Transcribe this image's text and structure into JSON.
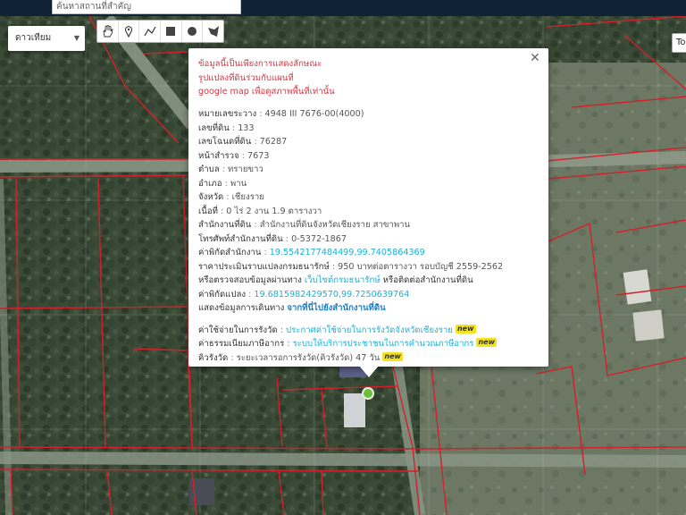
{
  "search": {
    "placeholder": "ค้นหาสถานที่สำคัญ"
  },
  "map_type": {
    "selected": "ดาวเทียม"
  },
  "toolbar": {
    "tools": [
      "hand-icon",
      "pin-icon",
      "polyline-icon",
      "square-icon",
      "circle-icon",
      "polygon-icon"
    ]
  },
  "top_right_button": {
    "label": "To"
  },
  "popup": {
    "warning": [
      "ข้อมูลนี้เป็นเพียงการแสดงลักษณะ",
      "รูปแปลงที่ดินร่วมกับแผนที่",
      "google map เพื่อดูสภาพพื้นที่เท่านั้น"
    ],
    "fields": {
      "map_sheet": {
        "label": "หมายเลขระวาง",
        "value": "4948 III 7676-00(4000)"
      },
      "parcel_no": {
        "label": "เลขที่ดิน",
        "value": "133"
      },
      "deed_no": {
        "label": "เลขโฉนดที่ดิน",
        "value": "76287"
      },
      "survey_page": {
        "label": "หน้าสำรวจ",
        "value": "7673"
      },
      "tambon": {
        "label": "ตำบล",
        "value": "ทรายขาว"
      },
      "amphoe": {
        "label": "อำเภอ",
        "value": "พาน"
      },
      "province": {
        "label": "จังหวัด",
        "value": "เชียงราย"
      },
      "area": {
        "label": "เนื้อที่",
        "value": "0 ไร่ 2 งาน 1.9 ตารางวา"
      },
      "land_office": {
        "label": "สำนักงานที่ดิน",
        "value": "สำนักงานที่ดินจังหวัดเชียงราย สาขาพาน"
      },
      "office_phone": {
        "label": "โทรศัพท์สำนักงานที่ดิน",
        "value": "0-5372-1867"
      },
      "office_coords": {
        "label": "ค่าพิกัดสำนักงาน",
        "value": "19.5542177484499,99.7405864369"
      },
      "appraisal": {
        "label": "ราคาประเมินราบแปลงกรมธนารักษ์",
        "value": "950 บาทต่อตารางวา รอบบัญชี 2559-2562"
      },
      "check_line": {
        "prefix": "หรือตรวจสอบข้อมูลผ่านทาง",
        "link": "เว็บไซต์กรมธนารักษ์",
        "suffix": "หรือติดต่อสำนักงานที่ดิน"
      },
      "parcel_coords": {
        "label": "ค่าพิกัดแปลง",
        "value": "19.6815982429570,99.7250639764"
      },
      "route_line": {
        "prefix": "แสดงข้อมูลการเดินทาง",
        "link": "จากที่นี่ไปยังสำนักงานที่ดิน"
      },
      "fee": {
        "label": "ค่าใช้จ่ายในการรังวัด",
        "link": "ประกาศค่าใช้จ่ายในการรังวัดจังหวัดเชียงราย",
        "badge": "new"
      },
      "tax": {
        "label": "ค่าธรรมเนียมภาษีอากร",
        "link": "ระบบให้บริการประชาชนในการคำนวณภาษีอากร",
        "badge": "new"
      },
      "queue": {
        "label": "คิวรังวัด",
        "value": "ระยะเวลารอการรังวัด(คิวรังวัด) 47 วัน",
        "badge": "new"
      }
    },
    "separator": ":"
  },
  "colors": {
    "parcel_line": "#d4202a",
    "link": "#1bb2d3",
    "warning": "#d6353f",
    "route_link": "#1e7fc4",
    "badge": "#f3e31d",
    "marker": "#6bbf3c"
  }
}
